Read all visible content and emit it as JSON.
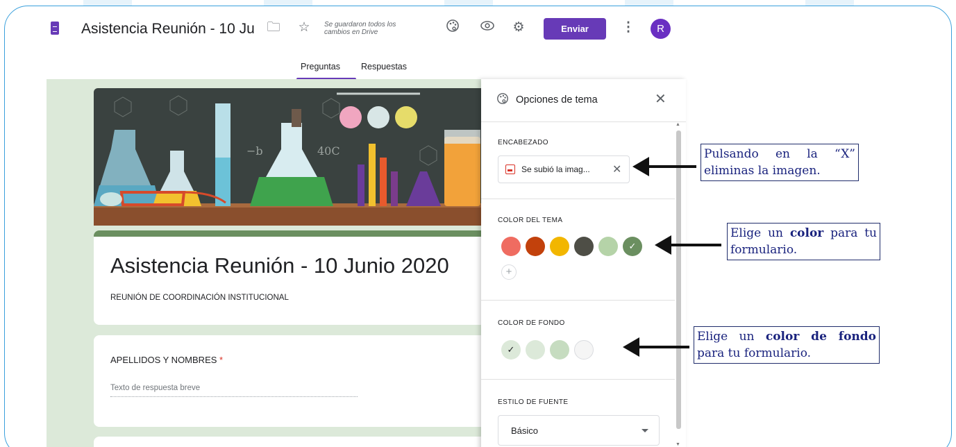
{
  "header": {
    "doc_title": "Asistencia Reunión - 10 Ju",
    "save_status": "Se guardaron todos los cambios en Drive",
    "send_label": "Enviar",
    "avatar_letter": "R",
    "icons": [
      "forms-logo-icon",
      "folder-icon",
      "star-icon",
      "palette-icon",
      "eye-icon",
      "gear-icon",
      "more-vert-icon"
    ]
  },
  "tabs": [
    {
      "label": "Preguntas",
      "active": true
    },
    {
      "label": "Respuestas",
      "active": false
    }
  ],
  "form": {
    "title": "Asistencia Reunión - 10 Junio 2020",
    "description": "REUNIÓN DE COORDINACIÓN INSTITUCIONAL",
    "question_title": "APELLIDOS Y NOMBRES",
    "required_mark": "*",
    "answer_hint": "Texto de respuesta breve"
  },
  "theme_panel": {
    "title": "Opciones de tema",
    "header_label": "ENCABEZADO",
    "header_chip": "Se subió la imag...",
    "theme_color_label": "COLOR DEL TEMA",
    "theme_colors": [
      "#ef6c61",
      "#c2410c",
      "#f2b600",
      "#4e4e46",
      "#b5d3a8",
      "#6b8f60"
    ],
    "theme_selected": 5,
    "background_label": "COLOR DE FONDO",
    "background_colors": [
      "#dce9d9",
      "#dce9d9",
      "#c6dcc0",
      "#f5f5f5"
    ],
    "background_selected": 0,
    "font_label": "ESTILO DE FUENTE",
    "font_value": "Básico",
    "add_symbol": "+"
  },
  "callouts": {
    "remove_image": {
      "pre": "Pulsando en la “X” eliminas la imagen."
    },
    "theme_color": {
      "pre": "Elige un ",
      "bold": "color",
      "post": " para tu formulario."
    },
    "background_color": {
      "pre": "Elige un ",
      "bold": "color de fondo",
      "post": " para tu formulario."
    }
  }
}
